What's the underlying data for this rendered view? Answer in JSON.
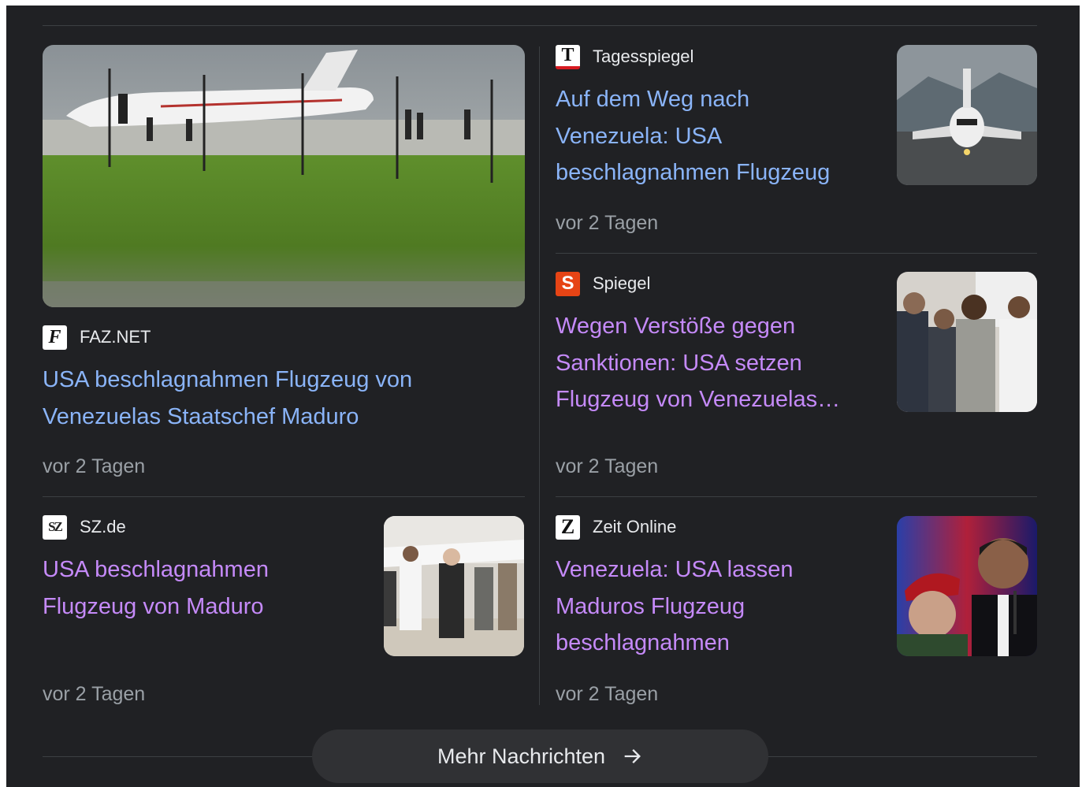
{
  "featured": {
    "source": "FAZ.NET",
    "favicon_icon": "faz-logo-icon",
    "title": "USA beschlagnahmen Flugzeug von Venezuelas Staatschef Maduro",
    "time": "vor 2 Tagen"
  },
  "articles": [
    {
      "source": "Tagesspiegel",
      "favicon_letter": "T",
      "title": "Auf dem Weg nach Venezuela: USA beschlagnahmen Flugzeug",
      "time": "vor 2 Tagen"
    },
    {
      "source": "Spiegel",
      "favicon_letter": "S",
      "title": "Wegen Verstöße gegen Sanktionen: USA setzen Flugzeug von Venezuelas Staatschef fest",
      "time": "vor 2 Tagen"
    },
    {
      "source": "SZ.de",
      "favicon_letter": "SZ",
      "title": "USA beschlagnahmen Flugzeug von Maduro",
      "time": "vor 2 Tagen"
    },
    {
      "source": "Zeit Online",
      "favicon_letter": "Z",
      "title": "Venezuela: USA lassen Maduros Flugzeug beschlagnahmen",
      "time": "vor 2 Tagen"
    }
  ],
  "more_button": {
    "label": "Mehr Nachrichten",
    "icon": "arrow-right-icon"
  },
  "colors": {
    "background": "#202124",
    "link_unvisited": "#8ab4f8",
    "link_visited": "#c58af9",
    "meta_text": "#9aa0a6"
  }
}
